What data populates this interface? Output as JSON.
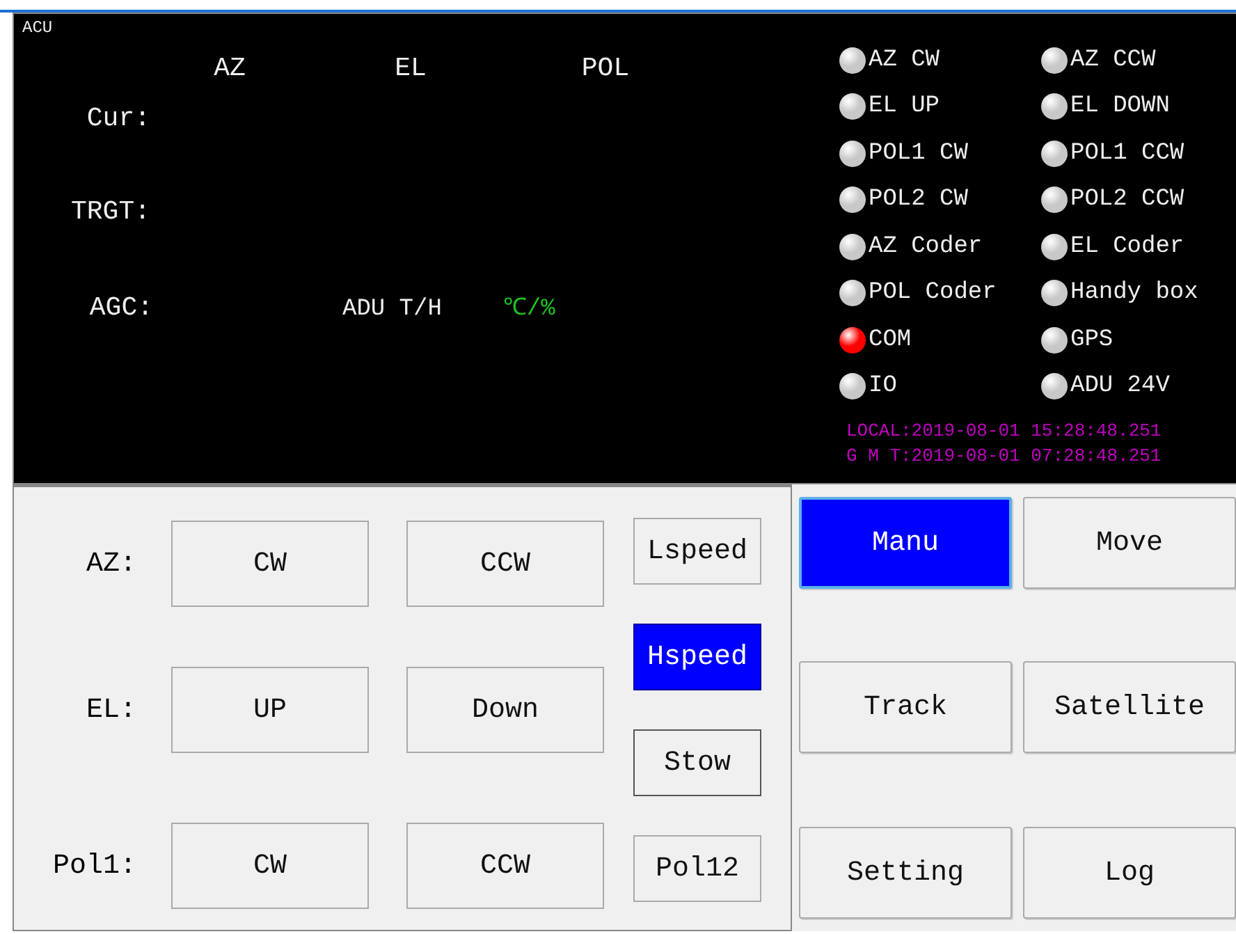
{
  "monitor": {
    "title": "ACU",
    "columns": [
      "AZ",
      "EL",
      "POL"
    ],
    "rows": [
      {
        "label": "Cur:"
      },
      {
        "label": "TRGT:"
      }
    ],
    "agc": {
      "label": "AGC:",
      "adu_label": "ADU T/H",
      "adu_unit": "℃/%"
    },
    "indicators": [
      {
        "label": "AZ CW",
        "color": "#c8c8c8"
      },
      {
        "label": "AZ CCW",
        "color": "#c8c8c8"
      },
      {
        "label": "EL UP",
        "color": "#c8c8c8"
      },
      {
        "label": "EL DOWN",
        "color": "#c8c8c8"
      },
      {
        "label": "POL1 CW",
        "color": "#c8c8c8"
      },
      {
        "label": "POL1 CCW",
        "color": "#c8c8c8"
      },
      {
        "label": "POL2 CW",
        "color": "#c8c8c8"
      },
      {
        "label": "POL2 CCW",
        "color": "#c8c8c8"
      },
      {
        "label": "AZ Coder",
        "color": "#c8c8c8"
      },
      {
        "label": "EL Coder",
        "color": "#c8c8c8"
      },
      {
        "label": "POL Coder",
        "color": "#c8c8c8"
      },
      {
        "label": "Handy box",
        "color": "#c8c8c8"
      },
      {
        "label": "COM",
        "color": "#ff0000"
      },
      {
        "label": "GPS",
        "color": "#c8c8c8"
      },
      {
        "label": "IO",
        "color": "#c8c8c8"
      },
      {
        "label": "ADU 24V",
        "color": "#c8c8c8"
      }
    ],
    "local_time": "LOCAL:2019-08-01 15:28:48.251",
    "gmt_time": "G M T:2019-08-01 07:28:48.251"
  },
  "axes": [
    {
      "label": "AZ:",
      "buttons": [
        "CW",
        "CCW"
      ]
    },
    {
      "label": "EL:",
      "buttons": [
        "UP",
        "Down"
      ]
    },
    {
      "label": "Pol1:",
      "buttons": [
        "CW",
        "CCW"
      ]
    }
  ],
  "options": [
    {
      "label": "Lspeed",
      "selected": false
    },
    {
      "label": "Hspeed",
      "selected": true
    },
    {
      "label": "Stow",
      "selected": false
    },
    {
      "label": "Pol12",
      "selected": false
    }
  ],
  "modes": [
    {
      "label": "Manu",
      "selected": true
    },
    {
      "label": "Move",
      "selected": false
    },
    {
      "label": "Track",
      "selected": false
    },
    {
      "label": "Satellite",
      "selected": false
    },
    {
      "label": "Setting",
      "selected": false
    },
    {
      "label": "Log",
      "selected": false
    }
  ]
}
